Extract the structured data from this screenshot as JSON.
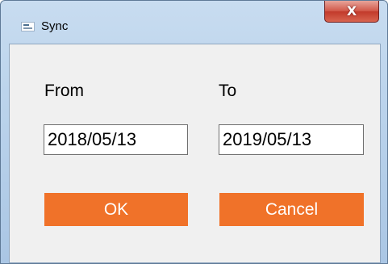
{
  "window": {
    "title": "Sync",
    "app_icon": "sync-app-icon",
    "close_glyph": "X"
  },
  "form": {
    "from_label": "From",
    "to_label": "To",
    "from_value": "2018/05/13",
    "to_value": "2019/05/13"
  },
  "buttons": {
    "ok_label": "OK",
    "cancel_label": "Cancel"
  },
  "colors": {
    "button_accent": "#f07229",
    "close_button": "#c23a2b",
    "titlebar": "#bcd4ec"
  }
}
